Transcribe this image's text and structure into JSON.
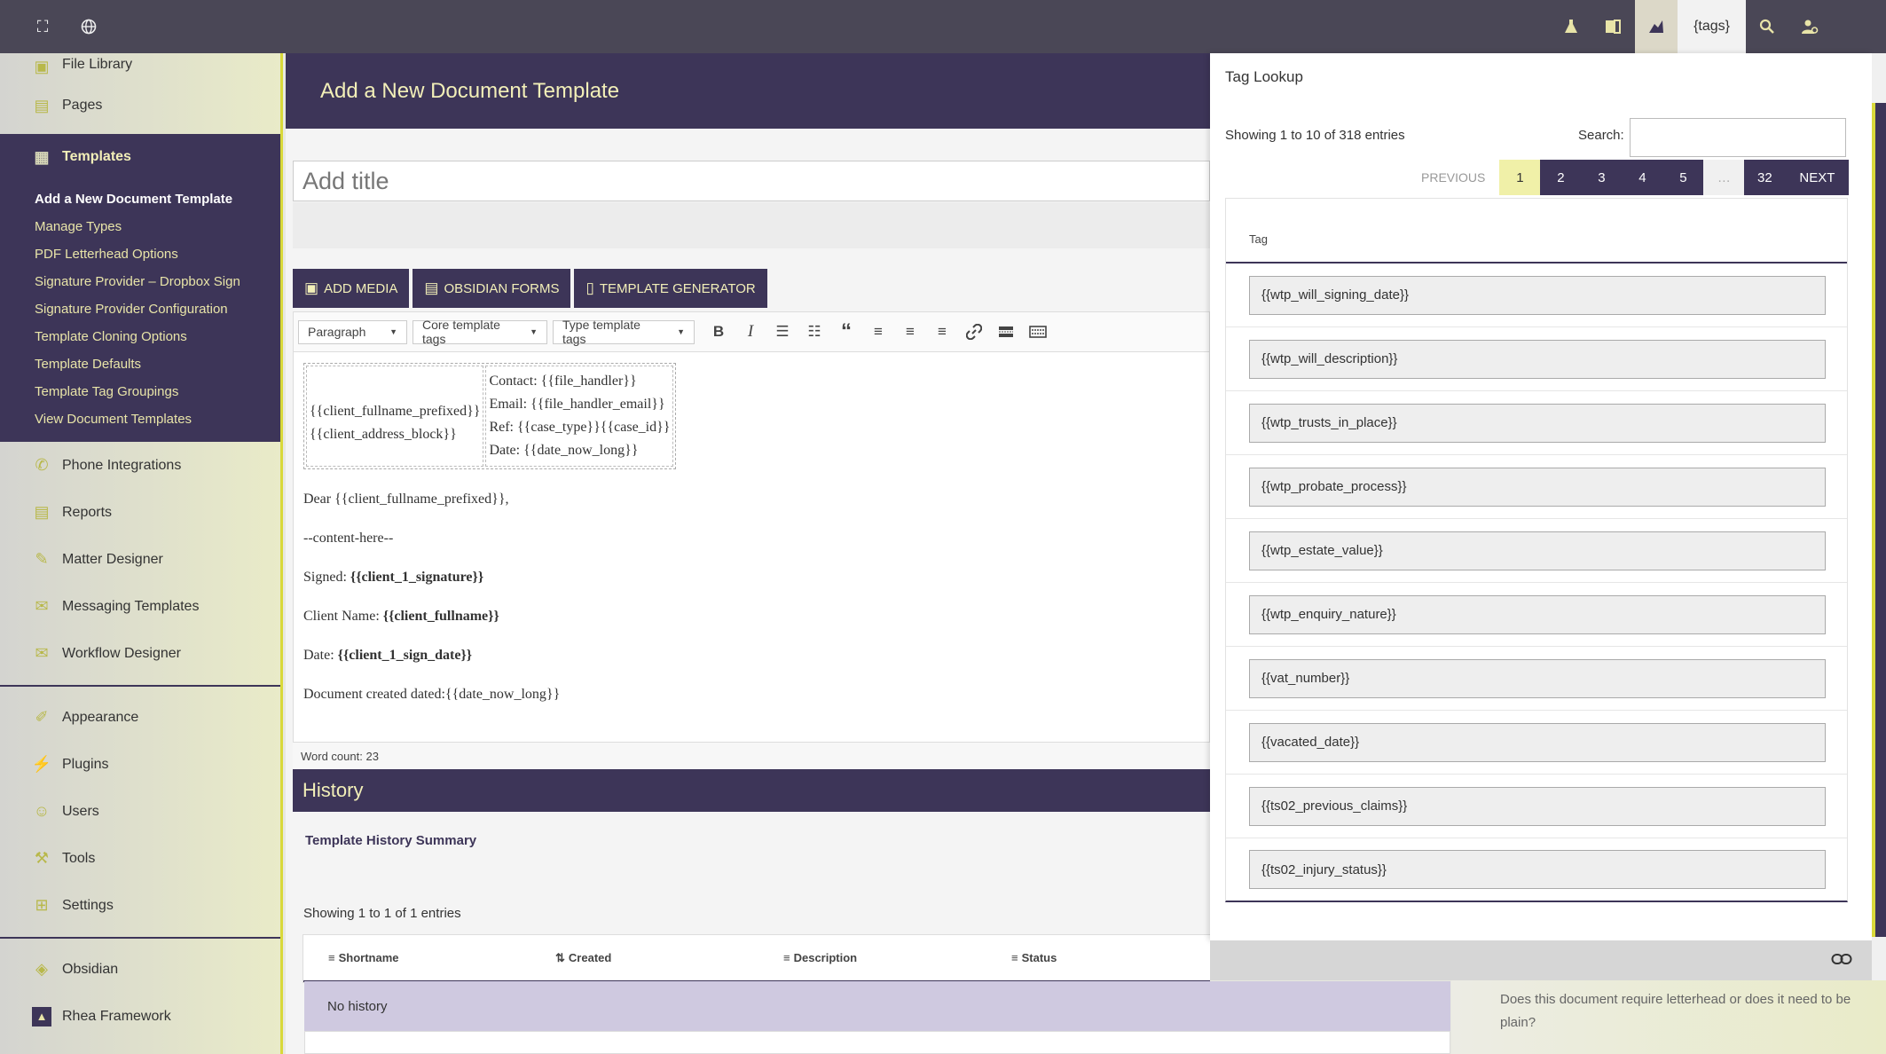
{
  "topbar": {
    "tags_label": "{tags}",
    "icons": [
      "fullscreen-icon",
      "globe-icon",
      "flask-icon",
      "book-icon",
      "rhea-icon",
      "search-icon",
      "user-cog-icon"
    ]
  },
  "sidebar": {
    "items_top": [
      {
        "label": "File Library",
        "icon": "file-library-icon"
      },
      {
        "label": "Pages",
        "icon": "pages-icon"
      }
    ],
    "active": {
      "label": "Templates",
      "icon": "templates-icon"
    },
    "submenu": [
      "Add a New Document Template",
      "Manage Types",
      "PDF Letterhead Options",
      "Signature Provider – Dropbox Sign",
      "Signature Provider Configuration",
      "Template Cloning Options",
      "Template Defaults",
      "Template Tag Groupings",
      "View Document Templates"
    ],
    "items_mid": [
      {
        "label": "Phone Integrations",
        "icon": "phone-icon"
      },
      {
        "label": "Reports",
        "icon": "reports-icon"
      },
      {
        "label": "Matter Designer",
        "icon": "matter-designer-icon"
      },
      {
        "label": "Messaging Templates",
        "icon": "envelope-icon"
      },
      {
        "label": "Workflow Designer",
        "icon": "envelope-icon"
      }
    ],
    "items_admin": [
      {
        "label": "Appearance",
        "icon": "brush-icon"
      },
      {
        "label": "Plugins",
        "icon": "plug-icon"
      },
      {
        "label": "Users",
        "icon": "user-icon"
      },
      {
        "label": "Tools",
        "icon": "wrench-icon"
      },
      {
        "label": "Settings",
        "icon": "settings-icon"
      }
    ],
    "items_bottom": [
      {
        "label": "Obsidian",
        "icon": "obsidian-icon"
      },
      {
        "label": "Rhea Framework",
        "icon": "rhea-icon"
      }
    ]
  },
  "main": {
    "page_title": "Add a New Document Template",
    "title_placeholder": "Add title",
    "buttons": {
      "add_media": "ADD MEDIA",
      "obsidian_forms": "OBSIDIAN FORMS",
      "template_generator": "TEMPLATE GENERATOR"
    },
    "toolbar": {
      "format_select": "Paragraph",
      "core_tags_select": "Core template tags",
      "type_tags_select": "Type template tags"
    },
    "content": {
      "addr_line1": "{{client_fullname_prefixed}}",
      "addr_line2": "{{client_address_block}}",
      "contact": "Contact: {{file_handler}}",
      "email": "Email: {{file_handler_email}}",
      "ref": "Ref: {{case_type}}{{case_id}}",
      "date": "Date: {{date_now_long}}",
      "greeting": "Dear {{client_fullname_prefixed}},",
      "body": "--content-here--",
      "signed_label": "Signed: ",
      "signed_value": "{{client_1_signature}}",
      "client_name_label": "Client Name: ",
      "client_name_value": "{{client_fullname}}",
      "sign_date_label": "Date: ",
      "sign_date_value": "{{client_1_sign_date}}",
      "created": "Document created dated:{{date_now_long}}"
    },
    "word_count": "Word count: 23",
    "history": {
      "title": "History",
      "summary_title": "Template History Summary",
      "showing": "Showing 1 to 1 of 1 entries",
      "columns": [
        "Shortname",
        "Created",
        "Description",
        "Status"
      ],
      "empty": "No history"
    }
  },
  "tag_lookup": {
    "title": "Tag Lookup",
    "showing": "Showing 1 to 10 of 318 entries",
    "search_label": "Search:",
    "search_value": "",
    "pagination": {
      "previous": "PREVIOUS",
      "pages": [
        "1",
        "2",
        "3",
        "4",
        "5"
      ],
      "ellipsis": "…",
      "last": "32",
      "next": "NEXT",
      "current": "1"
    },
    "column": "Tag",
    "tags": [
      "{{wtp_will_signing_date}}",
      "{{wtp_will_description}}",
      "{{wtp_trusts_in_place}}",
      "{{wtp_probate_process}}",
      "{{wtp_estate_value}}",
      "{{wtp_enquiry_nature}}",
      "{{vat_number}}",
      "{{vacated_date}}",
      "{{ts02_previous_claims}}",
      "{{ts02_injury_status}}"
    ]
  },
  "letterhead_question": "Does this document require letterhead or does it need to be plain?",
  "colors": {
    "primary": "#3d3558",
    "accent_yellow": "#f2efb8",
    "topbar": "#4a4756",
    "highlight": "#f0f0a8"
  }
}
